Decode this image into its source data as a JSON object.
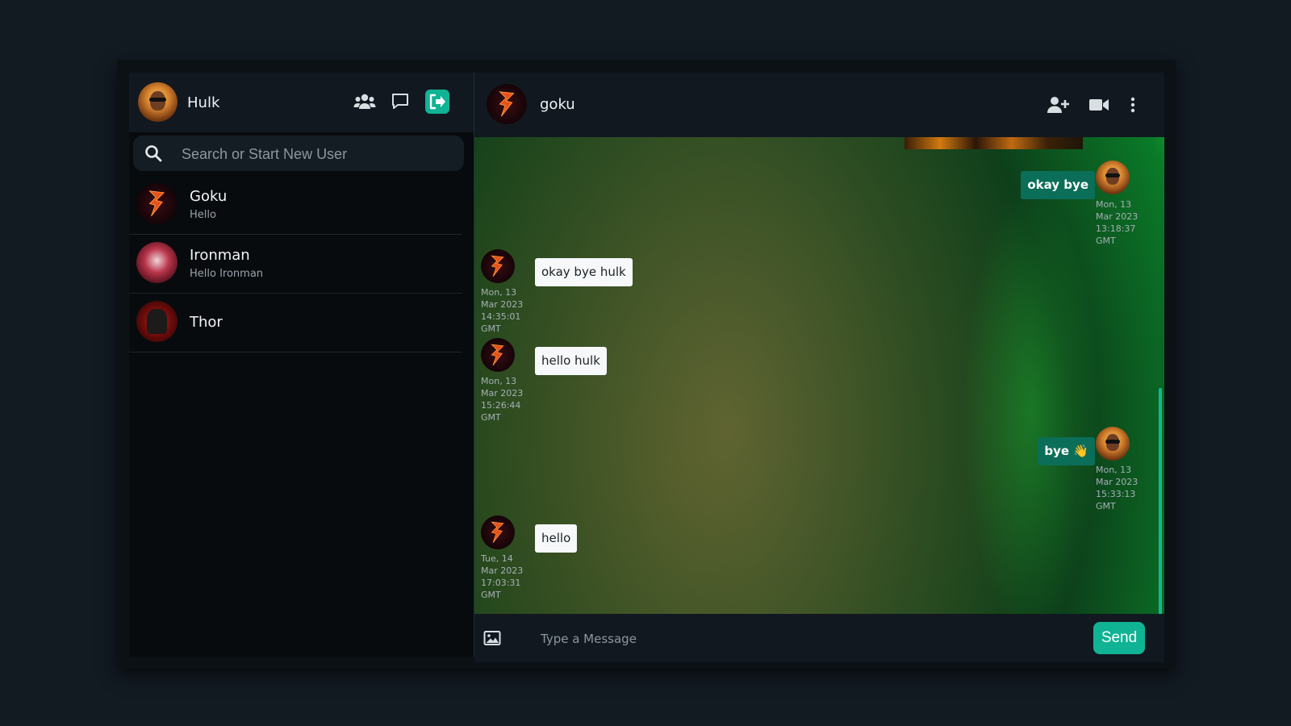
{
  "current_user": {
    "name": "Hulk"
  },
  "header_icons": [
    "users-icon",
    "chat-icon",
    "logout-icon"
  ],
  "search": {
    "placeholder": "Search or Start New User"
  },
  "contacts": [
    {
      "name": "Goku",
      "last_message": "Hello"
    },
    {
      "name": "Ironman",
      "last_message": "Hello Ironman"
    },
    {
      "name": "Thor",
      "last_message": ""
    }
  ],
  "chat": {
    "name": "goku",
    "header_icons": [
      "add-user-icon",
      "video-call-icon",
      "more-options-icon"
    ],
    "messages": [
      {
        "direction": "out",
        "text": "okay bye",
        "time_lines": [
          "Mon, 13",
          "Mar 2023",
          "13:18:37",
          "GMT"
        ]
      },
      {
        "direction": "in",
        "text": "okay bye hulk",
        "time_lines": [
          "Mon, 13",
          "Mar 2023",
          "14:35:01",
          "GMT"
        ]
      },
      {
        "direction": "in",
        "text": "hello hulk",
        "time_lines": [
          "Mon, 13",
          "Mar 2023",
          "15:26:44",
          "GMT"
        ]
      },
      {
        "direction": "out",
        "text": "bye 👋",
        "time_lines": [
          "Mon, 13",
          "Mar 2023",
          "15:33:13",
          "GMT"
        ]
      },
      {
        "direction": "in",
        "text": "hello",
        "time_lines": [
          "Tue, 14",
          "Mar 2023",
          "17:03:31",
          "GMT"
        ]
      }
    ]
  },
  "composer": {
    "placeholder": "Type a Message",
    "send_label": "Send"
  },
  "colors": {
    "accent": "#10b394",
    "outgoing_bubble": "#0b6e58",
    "incoming_bubble": "#f6f8f9",
    "panel_header": "#111820"
  }
}
